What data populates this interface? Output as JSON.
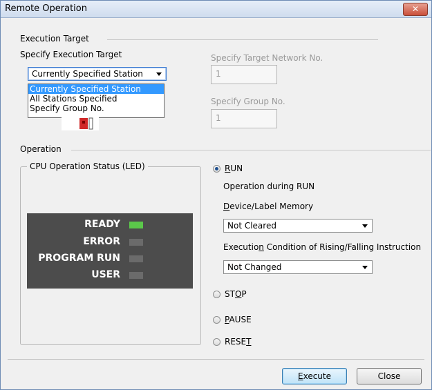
{
  "window": {
    "title": "Remote Operation",
    "close_icon": "close-icon"
  },
  "execution_target": {
    "group_label": "Execution Target",
    "specify_label": "Specify Execution Target",
    "selected": "Currently Specified Station",
    "options": [
      "Currently Specified Station",
      "All Stations Specified",
      "Specify Group No."
    ],
    "network_label": "Specify Target Network No.",
    "network_value": "1",
    "group_no_label": "Specify Group No.",
    "group_no_value": "1"
  },
  "operation": {
    "group_label": "Operation",
    "cpu_status_label": "CPU Operation Status (LED)",
    "leds": [
      {
        "label": "READY",
        "color": "#5bc84a"
      },
      {
        "label": "ERROR",
        "color": "#6b6b6b"
      },
      {
        "label": "PROGRAM RUN",
        "color": "#6b6b6b"
      },
      {
        "label": "USER",
        "color": "#6b6b6b"
      }
    ],
    "run_label": "RUN",
    "operation_during_run": "Operation during RUN",
    "device_label": "Device/Label Memory",
    "device_value": "Not Cleared",
    "execution_condition_label": "Execution Condition of Rising/Falling Instruction",
    "execution_condition_value": "Not Changed",
    "stop_label": "STOP",
    "pause_label": "PAUSE",
    "reset_label": "RESET",
    "selected_mode": "RUN"
  },
  "buttons": {
    "execute": "Execute",
    "close": "Close"
  }
}
